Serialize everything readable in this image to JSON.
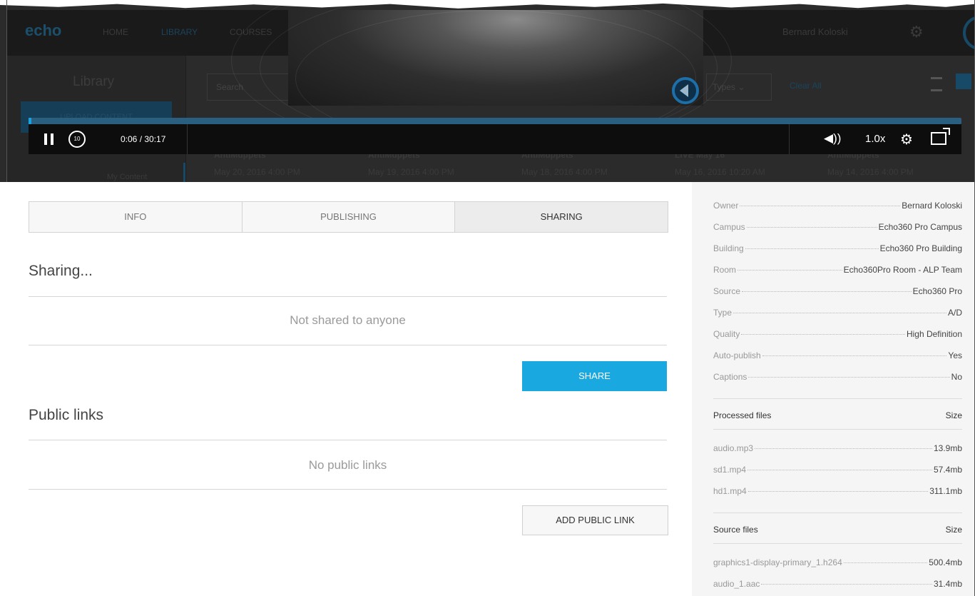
{
  "background_app": {
    "logo": "echo",
    "nav": [
      "HOME",
      "LIBRARY",
      "COURSES"
    ],
    "user": "Bernard Koloski",
    "sidebar_title": "Library",
    "upload_button": "UPLOAD CONTENT",
    "sidebar_item": "My Content",
    "search_placeholder": "Search",
    "types_filter": "Types",
    "clear_all": "Clear All",
    "cards": [
      {
        "title": "AntiMuppets",
        "date": "May 20, 2016 4:00 PM"
      },
      {
        "title": "AntiMuppets",
        "date": "May 19, 2016 4:00 PM"
      },
      {
        "title": "AntiMuppets",
        "date": "May 18, 2016 4:00 PM"
      },
      {
        "title": "LIVE May 16",
        "date": "May 16, 2016 10:20 AM"
      },
      {
        "title": "AntiMuppets",
        "date": "May 14, 2016 4:00 PM"
      }
    ]
  },
  "player": {
    "time": "0:06 / 30:17",
    "speed": "1.0x",
    "rewind_label": "10",
    "progress_fraction": 0.0033
  },
  "tabs": [
    {
      "label": "INFO",
      "active": false
    },
    {
      "label": "PUBLISHING",
      "active": false
    },
    {
      "label": "SHARING",
      "active": true
    }
  ],
  "sharing": {
    "title": "Sharing...",
    "empty_text": "Not shared to anyone",
    "share_button": "SHARE"
  },
  "public_links": {
    "title": "Public links",
    "empty_text": "No public links",
    "add_button": "ADD PUBLIC LINK"
  },
  "details": [
    {
      "key": "Owner",
      "value": "Bernard Koloski"
    },
    {
      "key": "Campus",
      "value": "Echo360 Pro Campus"
    },
    {
      "key": "Building",
      "value": "Echo360 Pro Building"
    },
    {
      "key": "Room",
      "value": "Echo360Pro Room - ALP Team"
    },
    {
      "key": "Source",
      "value": "Echo360 Pro"
    },
    {
      "key": "Type",
      "value": "A/D"
    },
    {
      "key": "Quality",
      "value": "High Definition"
    },
    {
      "key": "Auto-publish",
      "value": "Yes"
    },
    {
      "key": "Captions",
      "value": "No"
    }
  ],
  "processed_files": {
    "header": "Processed files",
    "size_header": "Size",
    "files": [
      {
        "name": "audio.mp3",
        "size": "13.9mb"
      },
      {
        "name": "sd1.mp4",
        "size": "57.4mb"
      },
      {
        "name": "hd1.mp4",
        "size": "311.1mb"
      }
    ]
  },
  "source_files": {
    "header": "Source files",
    "size_header": "Size",
    "files": [
      {
        "name": "graphics1-display-primary_1.h264",
        "size": "500.4mb"
      },
      {
        "name": "audio_1.aac",
        "size": "31.4mb"
      }
    ]
  },
  "colors": {
    "accent": "#1aa8e0",
    "progress": "#2a5f80",
    "player_bg": "#0d0d0d"
  }
}
